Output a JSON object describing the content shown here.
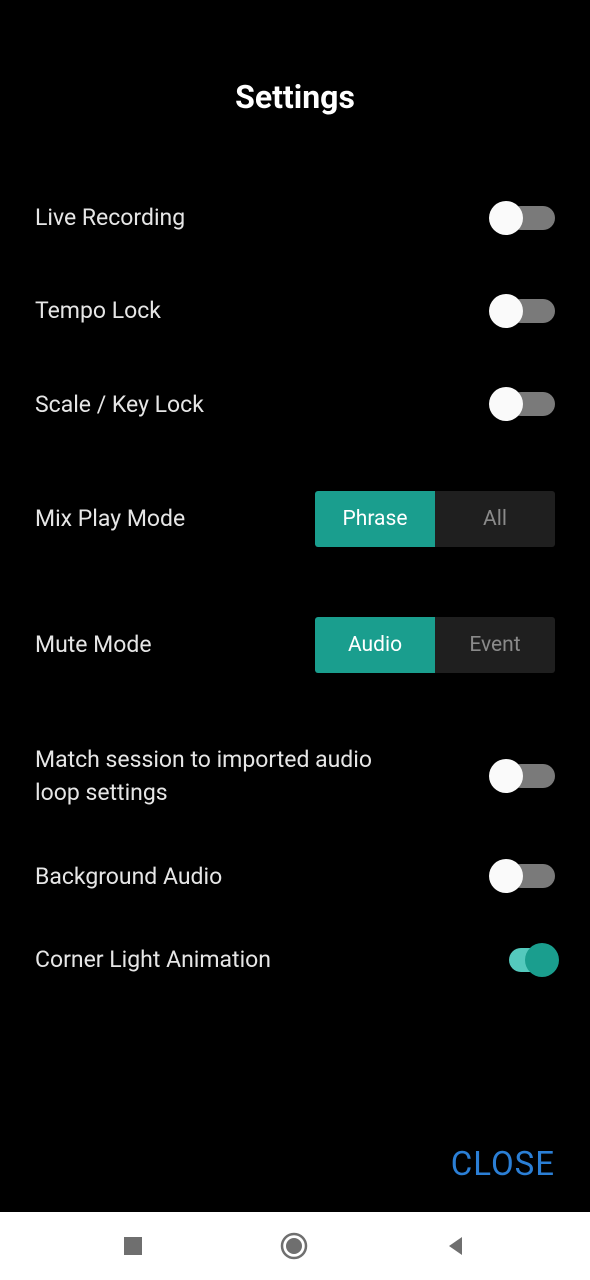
{
  "title": "Settings",
  "rows": {
    "live_recording": {
      "label": "Live Recording",
      "on": false
    },
    "tempo_lock": {
      "label": "Tempo Lock",
      "on": false
    },
    "scale_key_lock": {
      "label": "Scale / Key Lock",
      "on": false
    },
    "mix_play_mode": {
      "label": "Mix Play Mode",
      "options": [
        "Phrase",
        "All"
      ],
      "selected": "Phrase"
    },
    "mute_mode": {
      "label": "Mute Mode",
      "options": [
        "Audio",
        "Event"
      ],
      "selected": "Audio"
    },
    "match_session": {
      "label": "Match session to imported audio loop settings",
      "on": false
    },
    "background_audio": {
      "label": "Background Audio",
      "on": false
    },
    "corner_light": {
      "label": "Corner Light Animation",
      "on": true
    }
  },
  "close_label": "CLOSE"
}
